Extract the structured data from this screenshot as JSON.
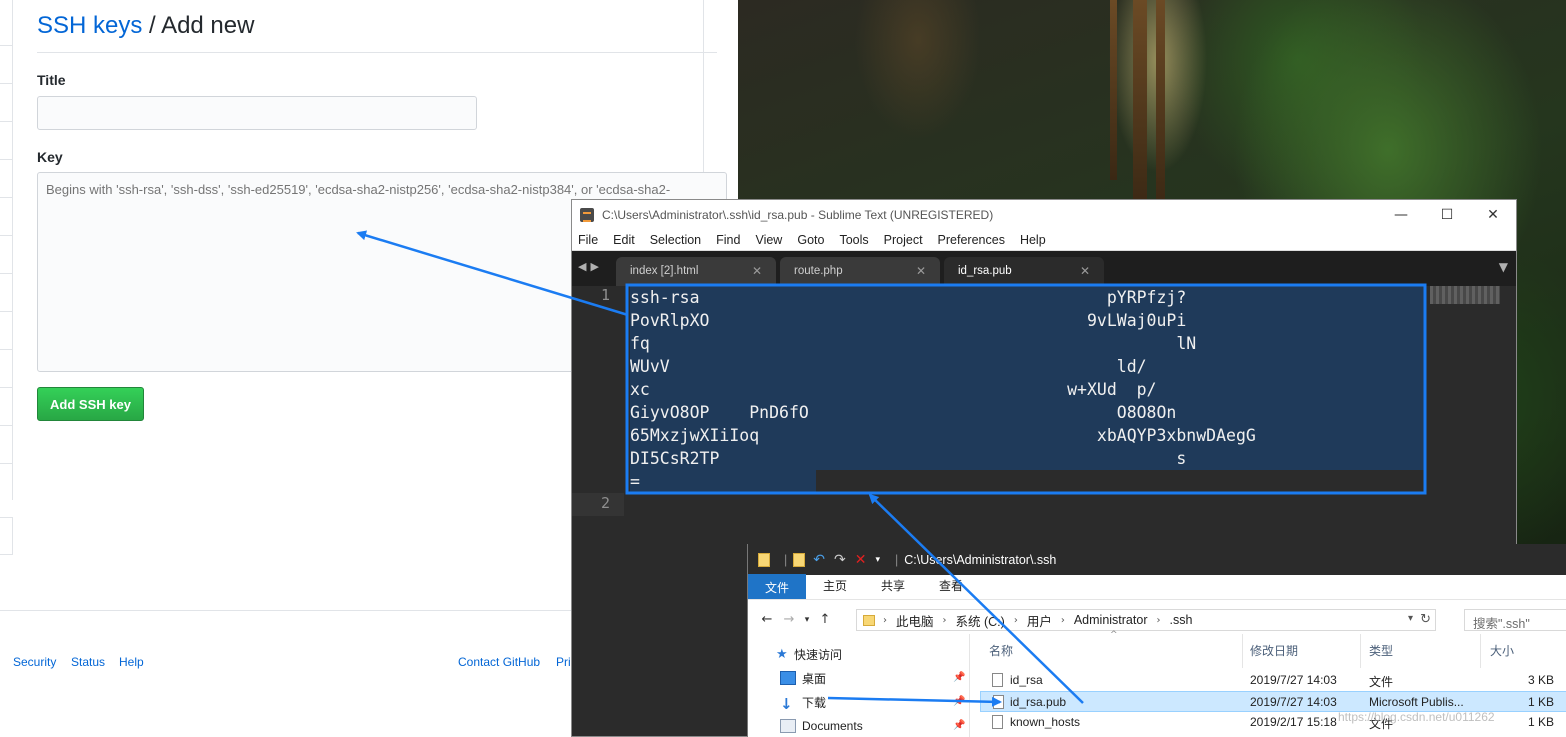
{
  "github": {
    "heading_link": "SSH keys",
    "heading_sep": " / ",
    "heading_rest": "Add new",
    "title_label": "Title",
    "title_value": "",
    "key_label": "Key",
    "key_placeholder": "Begins with 'ssh-rsa', 'ssh-dss', 'ssh-ed25519', 'ecdsa-sha2-nistp256', 'ecdsa-sha2-nistp384', or 'ecdsa-sha2-",
    "add_button": "Add SSH key",
    "footer": {
      "security": "Security",
      "status": "Status",
      "help": "Help",
      "contact": "Contact GitHub",
      "pri": "Pri"
    }
  },
  "sublime": {
    "window_title": "C:\\Users\\Administrator\\.ssh\\id_rsa.pub - Sublime Text (UNREGISTERED)",
    "menu": [
      "File",
      "Edit",
      "Selection",
      "Find",
      "View",
      "Goto",
      "Tools",
      "Project",
      "Preferences",
      "Help"
    ],
    "tabs": [
      {
        "label": "index [2].html",
        "active": false
      },
      {
        "label": "route.php",
        "active": false
      },
      {
        "label": "id_rsa.pub",
        "active": true
      }
    ],
    "line_numbers": [
      "1",
      "2"
    ],
    "code_lines": [
      "ssh-rsa                                         pYRPfzj?",
      "PovRlpXO                                      9vLWaj0uPi",
      "fq                                                     lN",
      "WUvV                                             ld/",
      "xc                                          w+XUd  p/",
      "GiyvO8OP    PnD6fO                               O8O8On",
      "65MxzjwXIiIoq                                  xbAQYP3xbnwDAegG",
      "DI5CsR2TP                                              s",
      "="
    ]
  },
  "explorer": {
    "title": "C:\\Users\\Administrator\\.ssh",
    "ribbon_tabs": [
      "文件",
      "主页",
      "共享",
      "查看"
    ],
    "breadcrumb": [
      "此电脑",
      "系统 (C:)",
      "用户",
      "Administrator",
      ".ssh"
    ],
    "search_placeholder": "搜索\".ssh\"",
    "nav_items": [
      "快速访问",
      "桌面",
      "下载",
      "Documents"
    ],
    "columns": [
      "名称",
      "修改日期",
      "类型",
      "大小"
    ],
    "files": [
      {
        "name": "id_rsa",
        "date": "2019/7/27 14:03",
        "type": "文件",
        "size": "3 KB",
        "selected": false
      },
      {
        "name": "id_rsa.pub",
        "date": "2019/7/27 14:03",
        "type": "Microsoft Publis...",
        "size": "1 KB",
        "selected": true
      },
      {
        "name": "known_hosts",
        "date": "2019/2/17 15:18",
        "type": "文件",
        "size": "1 KB",
        "selected": false
      }
    ],
    "watermark": "https://blog.csdn.net/u011262"
  },
  "annotations": {
    "highlight_color": "#1b7cf2",
    "arrow_color": "#1b7cf2"
  }
}
